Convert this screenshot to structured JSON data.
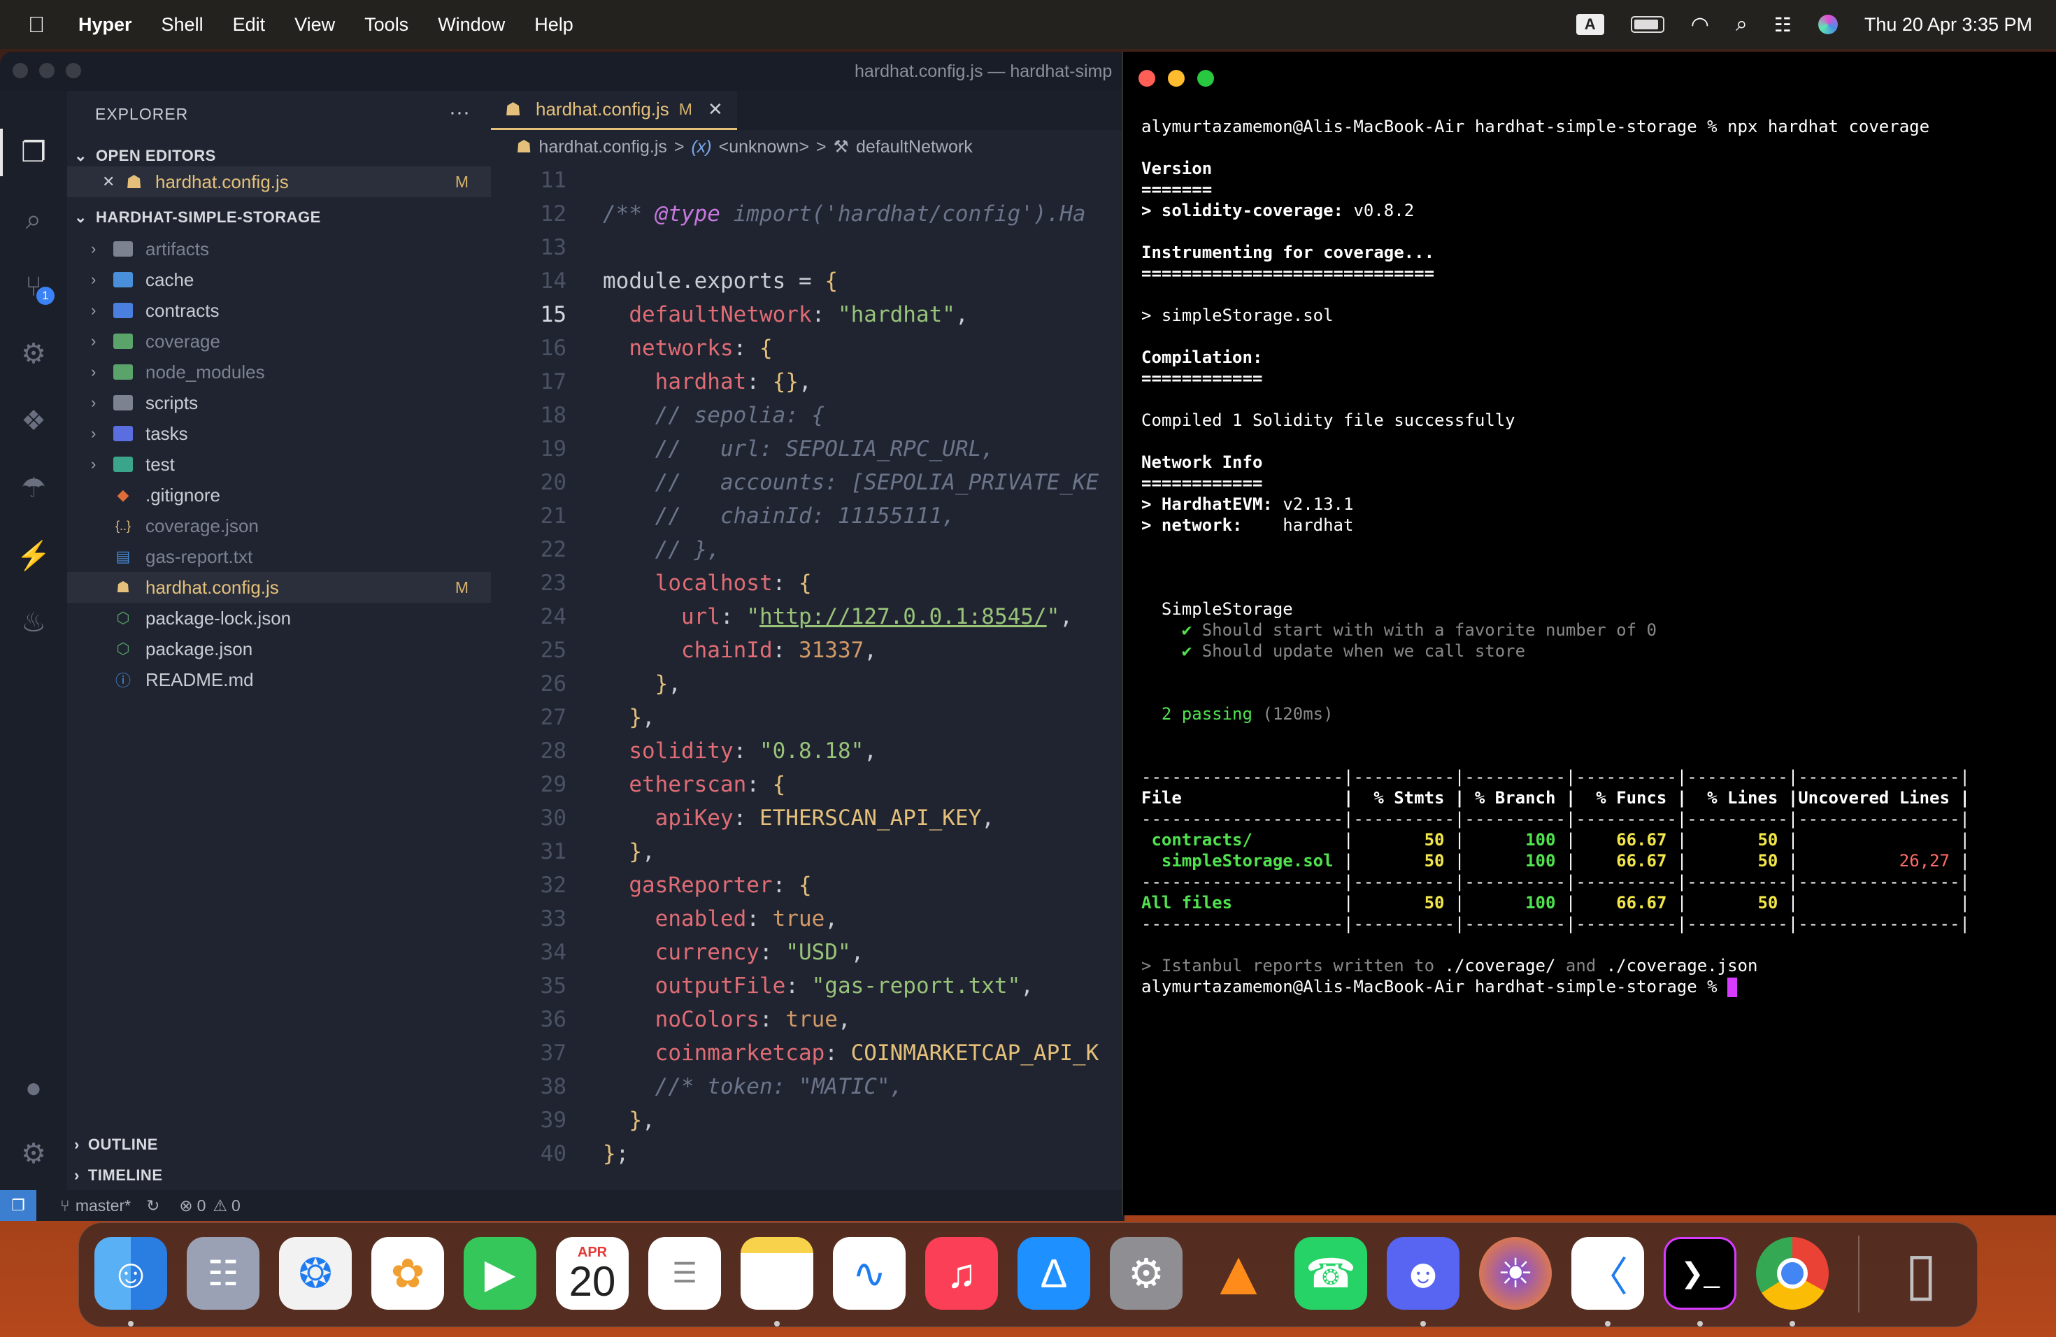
{
  "menubar": {
    "apple": "",
    "app": "Hyper",
    "items": [
      "Shell",
      "Edit",
      "View",
      "Tools",
      "Window",
      "Help"
    ],
    "input": "A",
    "clock": "Thu 20 Apr  3:35 PM"
  },
  "vscode": {
    "title": "hardhat.config.js — hardhat-simp",
    "explorer": "EXPLORER",
    "more": "···",
    "open_editors": "OPEN EDITORS",
    "project": "HARDHAT-SIMPLE-STORAGE",
    "open_file": "hardhat.config.js",
    "modified": "M",
    "scm_badge": "1",
    "tree": [
      {
        "name": "artifacts",
        "type": "folder",
        "color": "#7d8290"
      },
      {
        "name": "cache",
        "type": "folder",
        "color": "#4a8fd9"
      },
      {
        "name": "contracts",
        "type": "folder",
        "color": "#4a7fe0"
      },
      {
        "name": "coverage",
        "type": "folder",
        "color": "#5aa36a"
      },
      {
        "name": "node_modules",
        "type": "folder",
        "color": "#5aa36a"
      },
      {
        "name": "scripts",
        "type": "folder",
        "color": "#7d8290"
      },
      {
        "name": "tasks",
        "type": "folder",
        "color": "#5a6ee0"
      },
      {
        "name": "test",
        "type": "folder",
        "color": "#3aa58a"
      },
      {
        "name": ".gitignore",
        "type": "file",
        "icon": "◆",
        "color": "#e06c3a"
      },
      {
        "name": "coverage.json",
        "type": "file",
        "icon": "{..}",
        "color": "#e5c07b"
      },
      {
        "name": "gas-report.txt",
        "type": "file",
        "icon": "▤",
        "color": "#4a8fd9"
      },
      {
        "name": "hardhat.config.js",
        "type": "file",
        "icon": "☗",
        "color": "#e5c07b"
      },
      {
        "name": "package-lock.json",
        "type": "file",
        "icon": "⬡",
        "color": "#5aa36a"
      },
      {
        "name": "package.json",
        "type": "file",
        "icon": "⬡",
        "color": "#5aa36a"
      },
      {
        "name": "README.md",
        "type": "file",
        "icon": "ⓘ",
        "color": "#4a8fd9"
      }
    ],
    "outline": "OUTLINE",
    "timeline": "TIMELINE",
    "tab": "hardhat.config.js",
    "tab_mod": "M",
    "tab_close": "✕",
    "crumbs": {
      "file": "hardhat.config.js",
      "sep": ">",
      "unknown": "<unknown>",
      "prop": "defaultNetwork",
      "var": "(x)"
    },
    "status": {
      "branch": "master*",
      "errors": "0",
      "warnings": "0"
    },
    "line_numbers": [
      "11",
      "12",
      "13",
      "14",
      "15",
      "16",
      "17",
      "18",
      "19",
      "20",
      "21",
      "22",
      "23",
      "24",
      "25",
      "26",
      "27",
      "28",
      "29",
      "30",
      "31",
      "32",
      "33",
      "34",
      "35",
      "36",
      "37",
      "38",
      "39",
      "40"
    ]
  },
  "terminal": {
    "prompt": "alymurtazamemon@Alis-MacBook-Air hardhat-simple-storage %",
    "cmd": "npx hardhat coverage",
    "version_h": "Version",
    "version_u": "=======",
    "sc_label": "solidity-coverage:",
    "sc_ver": "v0.8.2",
    "instr": "Instrumenting for coverage...",
    "instr_u": "=============================",
    "instr_file": "simpleStorage.sol",
    "comp": "Compilation:",
    "comp_u": "============",
    "compiled": "Compiled 1 Solidity file successfully",
    "net": "Network Info",
    "net_u": "============",
    "evm_label": "HardhatEVM:",
    "evm_ver": "v2.13.1",
    "net_label": "network:",
    "net_val": "hardhat",
    "suite": "SimpleStorage",
    "t1": "Should start with with a favorite number of 0",
    "t2": "Should update when we call store",
    "pass": "2 passing",
    "pass_t": "(120ms)",
    "header": "File                |  % Stmts | % Branch |  % Funcs |  % Lines |Uncovered Lines |",
    "sep": "--------------------|----------|----------|----------|----------|----------------|",
    "r1": {
      "file": "contracts/",
      "stmts": "50",
      "branch": "100",
      "funcs": "66.67",
      "lines": "50",
      "unc": ""
    },
    "r2": {
      "file": "simpleStorage.sol",
      "stmts": "50",
      "branch": "100",
      "funcs": "66.67",
      "lines": "50",
      "unc": "26,27"
    },
    "r3": {
      "file": "All files",
      "stmts": "50",
      "branch": "100",
      "funcs": "66.67",
      "lines": "50",
      "unc": ""
    },
    "istanbul_a": "Istanbul reports written to",
    "istanbul_b": "./coverage/",
    "istanbul_c": "and",
    "istanbul_d": "./coverage.json"
  },
  "dock": {
    "calendar_month": "APR",
    "calendar_day": "20"
  }
}
